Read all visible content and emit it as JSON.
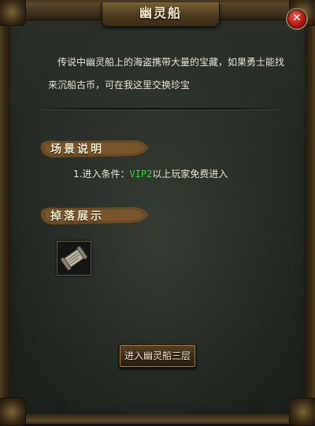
{
  "window": {
    "title": "幽灵船",
    "close_icon": "close-icon"
  },
  "intro_text": "传说中幽灵船上的海盗携带大量的宝藏，如果勇士能找来沉船古币，可在我这里交换珍宝",
  "scene_section": {
    "title": "场景说明",
    "condition_prefix": "1.进入条件：",
    "condition_vip": "VIP2",
    "condition_suffix": "以上玩家免费进入"
  },
  "drop_section": {
    "title": "掉落展示",
    "items": [
      {
        "icon": "scroll-item-icon"
      }
    ]
  },
  "enter_button": {
    "label": "进入幽灵船三层"
  },
  "colors": {
    "highlight_green": "#36d23e",
    "close_red": "#b3150c",
    "banner_brown": "#6b4a26"
  }
}
